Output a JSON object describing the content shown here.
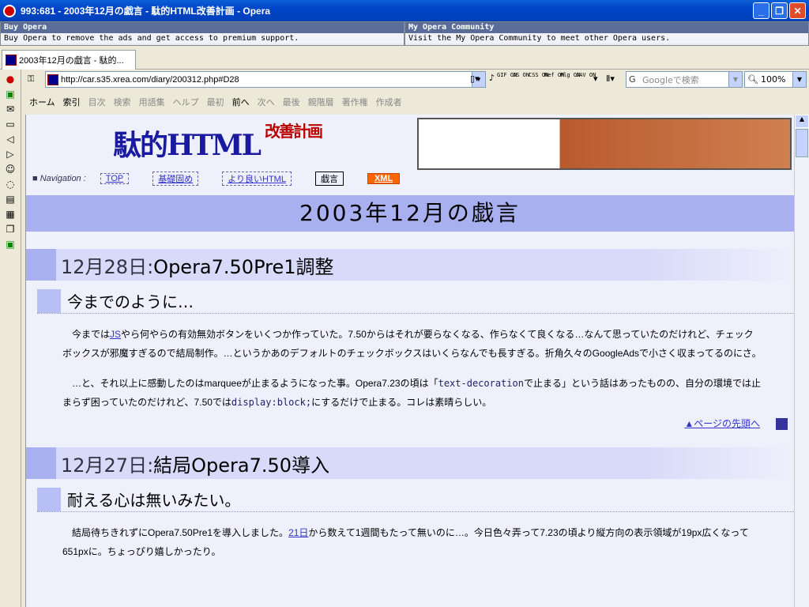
{
  "window": {
    "title": "993:681 - 2003年12月の戯言 - 駄的HTML改善計画 - Opera"
  },
  "ads": [
    {
      "heading": "Buy Opera",
      "text": "Buy Opera to remove the ads and get access to premium support."
    },
    {
      "heading": "My Opera Community",
      "text": "Visit the My Opera Community to meet other Opera users."
    }
  ],
  "tab": {
    "label": "2003年12月の戯言 - 駄的..."
  },
  "address": {
    "url": "http://car.s35.xrea.com/diary/200312.php#D28"
  },
  "toolbar": {
    "buttons": [
      "GIF ON",
      "JS ON",
      "CSS ON",
      "Ref ON",
      "Plg ON",
      "JAV ON"
    ],
    "search_placeholder": "Googleで検索",
    "zoom": "100%"
  },
  "navbar": {
    "items": [
      "ホーム",
      "索引",
      "目次",
      "検索",
      "用語集",
      "ヘルプ",
      "最初",
      "前へ",
      "次へ",
      "最後",
      "親階層",
      "著作権",
      "作成者"
    ]
  },
  "site": {
    "logo_main": "駄的HTML",
    "logo_sub": "改善計画",
    "nav_label": "■ Navigation :",
    "nav_links": [
      "TOP",
      "基礎固め",
      "より良いHTML",
      "戯言",
      "XML"
    ]
  },
  "page": {
    "title": "2003年12月の戯言",
    "entries": [
      {
        "date": "12月28日:",
        "heading": "Opera7.50Pre1調整",
        "subheading": "今までのように…",
        "p1a": "今までは",
        "p1link": "JS",
        "p1b": "やら何やらの有効無効ボタンをいくつか作っていた。7.50からはそれが要らなくなる、作らなくて良くなる…なんて思っていたのだけれど、チェックボックスが邪魔すぎるので結局制作。…というかあのデフォルトのチェックボックスはいくらなんでも長すぎる。折角久々のGoogleAdsで小さく収まってるのにさ。",
        "p2a": "…と、それ以上に感動したのはmarqueeが止まるようになった事。Opera7.23の頃は「",
        "p2code1": "text-decoration",
        "p2b": "で止まる」という話はあったものの、自分の環境では止まらず困っていたのだけれど、7.50では",
        "p2code2": "display:block;",
        "p2c": "にするだけで止まる。コレは素晴らしい。",
        "toplink": "▲ページの先頭へ"
      },
      {
        "date": "12月27日:",
        "heading": "結局Opera7.50導入",
        "subheading": "耐える心は無いみたい。",
        "p1a": "結局待ちきれずにOpera7.50Pre1を導入しました。",
        "p1link": "21日",
        "p1b": "から数えて1週間もたって無いのに…。今日色々弄って7.23の頃より縦方向の表示領域が19px広くなって651pxに。ちょっぴり嬉しかったり。"
      }
    ]
  }
}
